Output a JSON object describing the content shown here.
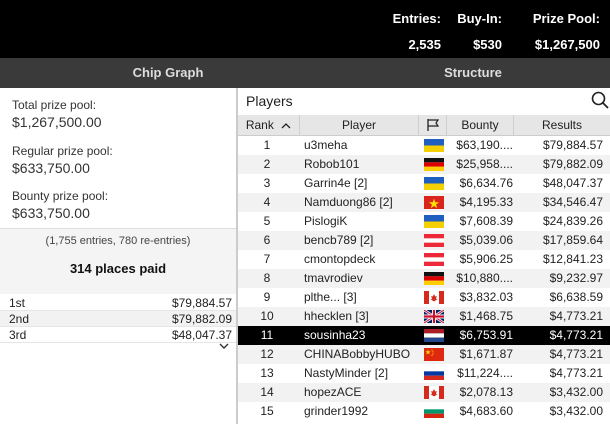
{
  "header": {
    "entries": {
      "label": "Entries:",
      "value": "2,535"
    },
    "buyin": {
      "label": "Buy-In:",
      "value": "$530"
    },
    "prize_pool": {
      "label": "Prize Pool:",
      "value": "$1,267,500"
    }
  },
  "tabs": {
    "chip_graph": "Chip Graph",
    "structure": "Structure"
  },
  "summary": {
    "total_label": "Total prize pool:",
    "total_value": "$1,267,500.00",
    "regular_label": "Regular prize pool:",
    "regular_value": "$633,750.00",
    "bounty_label": "Bounty prize pool:",
    "bounty_value": "$633,750.00",
    "entries_note": "(1,755 entries, 780 re-entries)",
    "places_paid": "314 places paid",
    "payouts": [
      {
        "place": "1st",
        "amount": "$79,884.57"
      },
      {
        "place": "2nd",
        "amount": "$79,882.09"
      },
      {
        "place": "3rd",
        "amount": "$48,047.37"
      }
    ]
  },
  "players": {
    "title": "Players",
    "columns": {
      "rank": "Rank",
      "player": "Player",
      "bounty": "Bounty",
      "results": "Results"
    },
    "rows": [
      {
        "rank": "1",
        "player": "u3meha",
        "flag": "ukraine",
        "bounty": "$63,190....",
        "results": "$79,884.57"
      },
      {
        "rank": "2",
        "player": "Robob101",
        "flag": "germany",
        "bounty": "$25,958....",
        "results": "$79,882.09"
      },
      {
        "rank": "3",
        "player": "Garrin4e [2]",
        "flag": "ukraine",
        "bounty": "$6,634.76",
        "results": "$48,047.37"
      },
      {
        "rank": "4",
        "player": "Namduong86 [2]",
        "flag": "vietnam",
        "bounty": "$4,195.33",
        "results": "$34,546.47"
      },
      {
        "rank": "5",
        "player": "PislogiK",
        "flag": "ukraine",
        "bounty": "$7,608.39",
        "results": "$24,839.26"
      },
      {
        "rank": "6",
        "player": "bencb789 [2]",
        "flag": "austria",
        "bounty": "$5,039.06",
        "results": "$17,859.64"
      },
      {
        "rank": "7",
        "player": "cmontopdeck",
        "flag": "austria",
        "bounty": "$5,906.25",
        "results": "$12,841.23"
      },
      {
        "rank": "8",
        "player": "tmavrodiev",
        "flag": "germany",
        "bounty": "$10,880....",
        "results": "$9,232.97"
      },
      {
        "rank": "9",
        "player": "plthe... [3]",
        "flag": "canada",
        "bounty": "$3,832.03",
        "results": "$6,638.59"
      },
      {
        "rank": "10",
        "player": "hhecklen [3]",
        "flag": "uk",
        "bounty": "$1,468.75",
        "results": "$4,773.21"
      },
      {
        "rank": "11",
        "player": "sousinha23",
        "flag": "netherlands",
        "bounty": "$6,753.91",
        "results": "$4,773.21"
      },
      {
        "rank": "12",
        "player": "CHINABobbyHUBO",
        "flag": "china",
        "bounty": "$1,671.87",
        "results": "$4,773.21"
      },
      {
        "rank": "13",
        "player": "NastyMinder [2]",
        "flag": "russia",
        "bounty": "$11,224....",
        "results": "$4,773.21"
      },
      {
        "rank": "14",
        "player": "hopezACE",
        "flag": "canada",
        "bounty": "$2,078.13",
        "results": "$3,432.00"
      },
      {
        "rank": "15",
        "player": "grinder1992",
        "flag": "bulgaria",
        "bounty": "$4,683.60",
        "results": "$3,432.00"
      }
    ]
  },
  "colors": {
    "header_bg": "#000000",
    "tabbar_bg": "#3a3a3a",
    "selected_row_bg": "#000000"
  }
}
